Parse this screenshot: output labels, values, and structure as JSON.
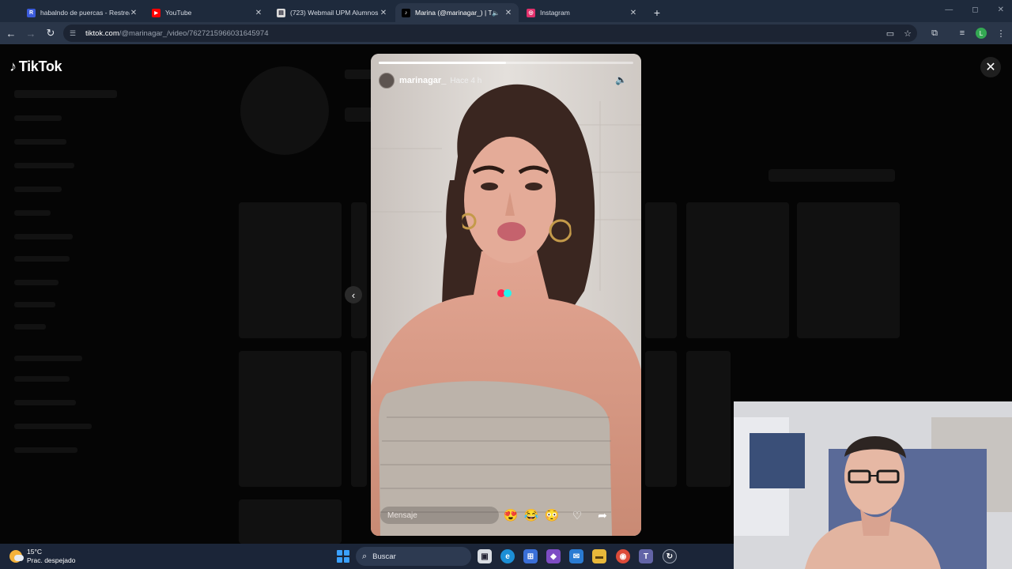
{
  "browser": {
    "tabs": [
      {
        "label": "habalndo de puercas - Restream",
        "favicon": "restream-icon",
        "color": "#3b5bdb",
        "active": false
      },
      {
        "label": "YouTube",
        "favicon": "youtube-icon",
        "color": "#ff0000",
        "active": false
      },
      {
        "label": "(723) Webmail UPM Alumnos",
        "favicon": "webmail-icon",
        "color": "#d9d9d9",
        "active": false
      },
      {
        "label": "Marina (@marinagar_) | TikTok",
        "favicon": "tiktok-icon",
        "color": "#000000",
        "active": true
      },
      {
        "label": "Instagram",
        "favicon": "instagram-icon",
        "color": "#e1306c",
        "active": false
      }
    ],
    "url_host": "tiktok.com",
    "url_path": "/@marinagar_/video/7627215966031645974",
    "profile_initial": "L"
  },
  "tiktok": {
    "logo_text": "TikTok"
  },
  "story": {
    "username": "marinagar_",
    "time_ago": "Hace 4 h",
    "progress": 0.5,
    "message_placeholder": "Mensaje",
    "reactions": [
      "😍",
      "😂",
      "😳"
    ]
  },
  "taskbar": {
    "temperature": "15°C",
    "weather": "Prac. despejado",
    "search_label": "Buscar"
  },
  "colors": {
    "tiktok_red": "#fe2c55",
    "tiktok_cyan": "#25f4ee"
  }
}
